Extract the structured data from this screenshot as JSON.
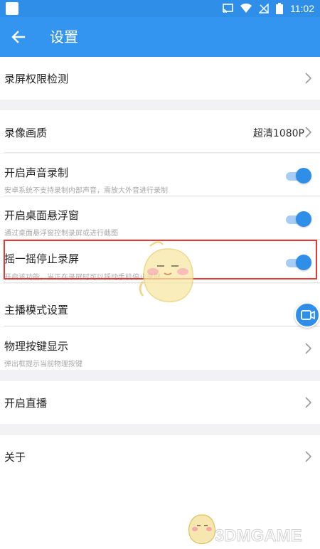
{
  "status_bar": {
    "time": "11:02"
  },
  "app_bar": {
    "title": "设置"
  },
  "settings": [
    {
      "label": "录屏权限检测"
    },
    {
      "label": "录像画质",
      "value": "超清1080P"
    },
    {
      "label": "开启声音录制",
      "sub": "安卓系统不支持录制内部声音，需放大外音进行录制",
      "enabled": true
    },
    {
      "label": "开启桌面悬浮窗",
      "sub": "通过桌面悬浮窗控制录屏或进行截图",
      "enabled": true
    },
    {
      "label": "摇一摇停止录屏",
      "sub": "开启该功能，当正在录屏时可以摇动手机停止录屏",
      "enabled": true
    },
    {
      "label": "主播模式设置"
    },
    {
      "label": "物理按键显示",
      "sub": "弹出框提示当前物理按键"
    },
    {
      "label": "开启直播"
    },
    {
      "label": "关于"
    }
  ],
  "watermark": "3DMGAME",
  "colors": {
    "primary": "#3395ef",
    "highlight": "#e53935"
  }
}
